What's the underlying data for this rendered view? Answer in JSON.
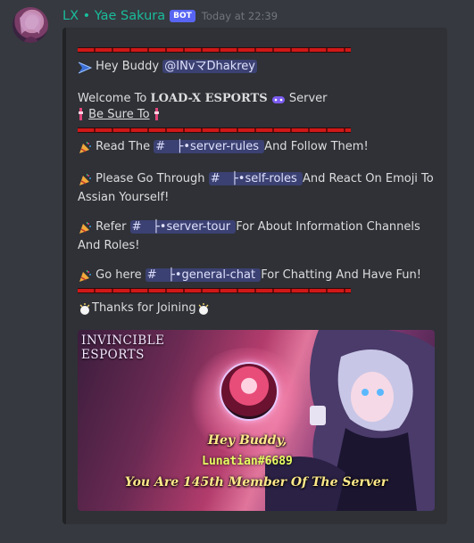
{
  "message": {
    "author": "LX • Yae Sakura",
    "bot_tag": "BOT",
    "timestamp": "Today at 22:39"
  },
  "embed": {
    "greeting_prefix": "Hey Buddy",
    "mention": "@INvマDhakrey",
    "welcome_prefix": "Welcome To",
    "server_name": "LOAD-X ESPORTS",
    "welcome_suffix": "Server",
    "be_sure": "Be Sure To",
    "lines": [
      {
        "prefix": "Read The",
        "channel": "#   ├•server-rules",
        "suffix": "And Follow Them!"
      },
      {
        "prefix": "Please Go Through",
        "channel": "#   ├•self-roles",
        "suffix": "And React On Emoji To Assian Yourself!"
      },
      {
        "prefix": "Refer",
        "channel": "#   ├•server-tour",
        "suffix": "For About Information Channels And Roles!"
      },
      {
        "prefix": "Go here",
        "channel": "#   ├•general-chat",
        "suffix": "For Chatting And Have Fun!"
      }
    ],
    "thanks": "Thanks for Joining"
  },
  "banner": {
    "title_line1": "INVINCIBLE",
    "title_line2": "ESPORTS",
    "hey": "Hey Buddy,",
    "user": "Lunatian#6689",
    "member_line": "You Are 145th Member Of The Server"
  },
  "colors": {
    "author": "#1abc9c",
    "bot_tag": "#5865f2",
    "mention_bg": "#3f4570",
    "divider": "#d01818"
  },
  "icons": [
    "avatar",
    "arrow-icon",
    "controller-icon",
    "party-popper-icon",
    "ribbon-icon",
    "chat-bubble-icon",
    "sparkle-icon"
  ]
}
